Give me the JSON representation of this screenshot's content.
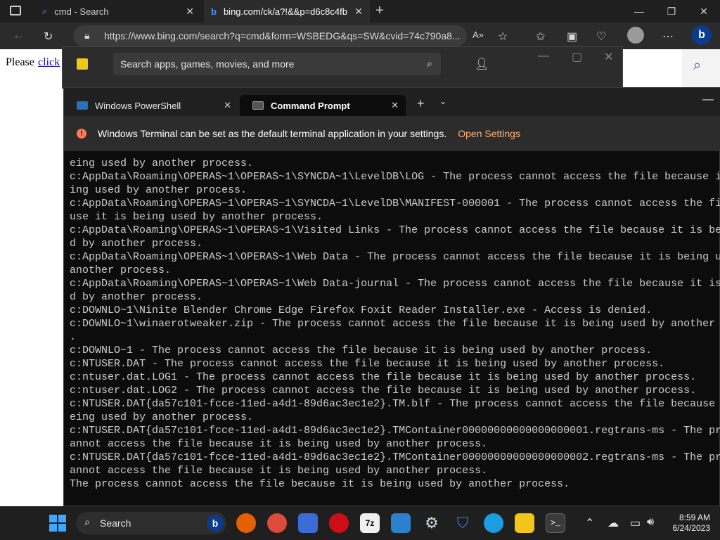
{
  "browser": {
    "tabs": [
      {
        "label": "cmd - Search"
      },
      {
        "label": "bing.com/ck/a?!&&p=d6c8c4fb"
      }
    ],
    "url": "https://www.bing.com/search?q=cmd&form=WSBEDG&qs=SW&cvid=74c790a8...",
    "page_text": "Please",
    "page_link": "click"
  },
  "start_search": {
    "placeholder": "Search apps, games, movies, and more"
  },
  "terminal": {
    "tabs": [
      {
        "label": "Windows PowerShell"
      },
      {
        "label": "Command Prompt"
      }
    ],
    "info_message": "Windows Terminal can be set as the default terminal application in your settings.",
    "info_link": "Open Settings",
    "output_lines": [
      "eing used by another process.",
      "c:AppData\\Roaming\\OPERAS~1\\OPERAS~1\\SYNCDA~1\\LevelDB\\LOG - The process cannot access the file because i",
      "ing used by another process.",
      "c:AppData\\Roaming\\OPERAS~1\\OPERAS~1\\SYNCDA~1\\LevelDB\\MANIFEST-000001 - The process cannot access the fi",
      "use it is being used by another process.",
      "c:AppData\\Roaming\\OPERAS~1\\OPERAS~1\\Visited Links - The process cannot access the file because it is be",
      "d by another process.",
      "c:AppData\\Roaming\\OPERAS~1\\OPERAS~1\\Web Data - The process cannot access the file because it is being u",
      "another process.",
      "c:AppData\\Roaming\\OPERAS~1\\OPERAS~1\\Web Data-journal - The process cannot access the file because it is",
      "d by another process.",
      "c:DOWNLO~1\\Ninite Blender Chrome Edge Firefox Foxit Reader Installer.exe - Access is denied.",
      "c:DOWNLO~1\\winaerotweaker.zip - The process cannot access the file because it is being used by another",
      ".",
      "c:DOWNLO~1 - The process cannot access the file because it is being used by another process.",
      "c:NTUSER.DAT - The process cannot access the file because it is being used by another process.",
      "c:ntuser.dat.LOG1 - The process cannot access the file because it is being used by another process.",
      "c:ntuser.dat.LOG2 - The process cannot access the file because it is being used by another process.",
      "c:NTUSER.DAT{da57c101-fcce-11ed-a4d1-89d6ac3ec1e2}.TM.blf - The process cannot access the file because",
      "eing used by another process.",
      "c:NTUSER.DAT{da57c101-fcce-11ed-a4d1-89d6ac3ec1e2}.TMContainer00000000000000000001.regtrans-ms - The pr",
      "annot access the file because it is being used by another process.",
      "c:NTUSER.DAT{da57c101-fcce-11ed-a4d1-89d6ac3ec1e2}.TMContainer00000000000000000002.regtrans-ms - The pr",
      "annot access the file because it is being used by another process.",
      "The process cannot access the file because it is being used by another process."
    ]
  },
  "taskbar": {
    "search_label": "Search",
    "time": "8:59 AM",
    "date": "6/24/2023"
  }
}
